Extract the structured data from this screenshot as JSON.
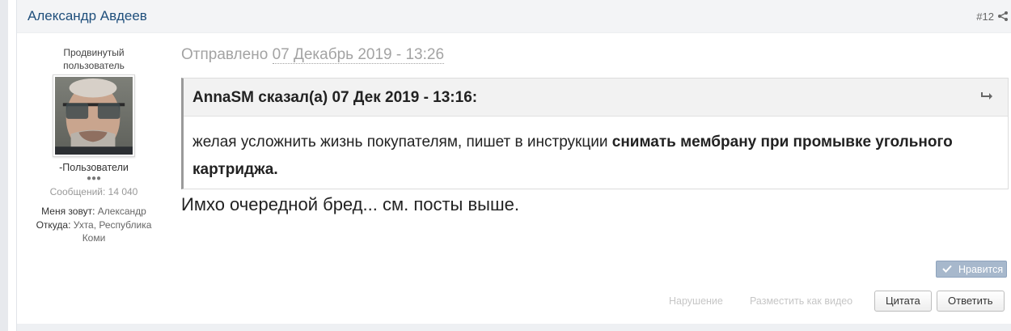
{
  "post": {
    "author_name": "Александр Авдеев",
    "post_number": "#12",
    "author": {
      "rank": "Продвинутый пользователь",
      "group": "-Пользователи",
      "pips": "●●●",
      "post_count": "Сообщений: 14 040",
      "fields": [
        {
          "key": "Меня зовут:",
          "value": "Александр"
        },
        {
          "key": "Откуда:",
          "value": "Ухта, Республика Коми"
        }
      ]
    },
    "posted_label": "Отправлено",
    "posted_date": "07 Декабрь 2019 - 13:26",
    "quote": {
      "title": "AnnaSM сказал(а) 07 Дек 2019 - 13:16:",
      "text_plain": " желая усложнить жизнь покупателям, пишет в инструкции ",
      "text_bold": "снимать мембрану при промывке угольного картриджа."
    },
    "text": "Имхо очередной бред... см. посты выше.",
    "like_label": "Нравится",
    "actions": {
      "report": "Нарушение",
      "video": "Разместить как видео",
      "quote": "Цитата",
      "reply": "Ответить"
    }
  },
  "colors": {
    "author_link": "#1f4f7c",
    "like_button": "#a7b8cc",
    "muted": "#a3a3a3"
  }
}
